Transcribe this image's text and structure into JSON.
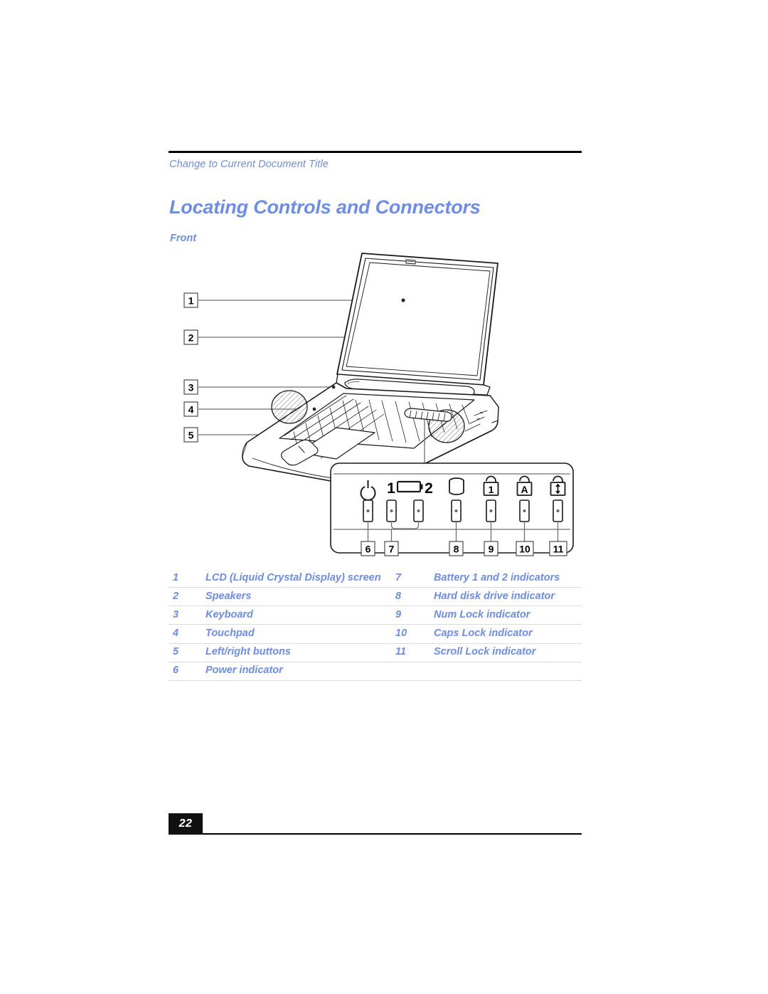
{
  "header": {
    "running_title": "Change to Current Document Title"
  },
  "title": "Locating Controls and Connectors",
  "subheading": "Front",
  "colors": {
    "accent_blue": "#6b8cf0",
    "rule_black": "#000000",
    "table_rule": "#d9dde2"
  },
  "figure": {
    "callouts_left": [
      "1",
      "2",
      "3",
      "4",
      "5"
    ],
    "indicator_panel": {
      "callouts": [
        "6",
        "7",
        "8",
        "9",
        "10",
        "11"
      ],
      "icons": [
        {
          "name": "power-icon",
          "label": ""
        },
        {
          "name": "battery-icon",
          "label_left": "1",
          "label_right": "2"
        },
        {
          "name": "hard-disk-icon",
          "label": ""
        },
        {
          "name": "num-lock-icon",
          "label": "1"
        },
        {
          "name": "caps-lock-icon",
          "label": "A"
        },
        {
          "name": "scroll-lock-icon",
          "label": "↕"
        }
      ]
    }
  },
  "parts": {
    "rows": [
      {
        "num": "1",
        "label": "LCD (Liquid Crystal Display) screen",
        "num2": "7",
        "label2": "Battery 1 and 2 indicators"
      },
      {
        "num": "2",
        "label": "Speakers",
        "num2": "8",
        "label2": "Hard disk drive indicator"
      },
      {
        "num": "3",
        "label": "Keyboard",
        "num2": "9",
        "label2": "Num Lock indicator"
      },
      {
        "num": "4",
        "label": "Touchpad",
        "num2": "10",
        "label2": "Caps Lock indicator"
      },
      {
        "num": "5",
        "label": "Left/right buttons",
        "num2": "11",
        "label2": "Scroll Lock indicator"
      },
      {
        "num": "6",
        "label": "Power indicator",
        "num2": "",
        "label2": ""
      }
    ]
  },
  "footer": {
    "page_number": "22"
  }
}
